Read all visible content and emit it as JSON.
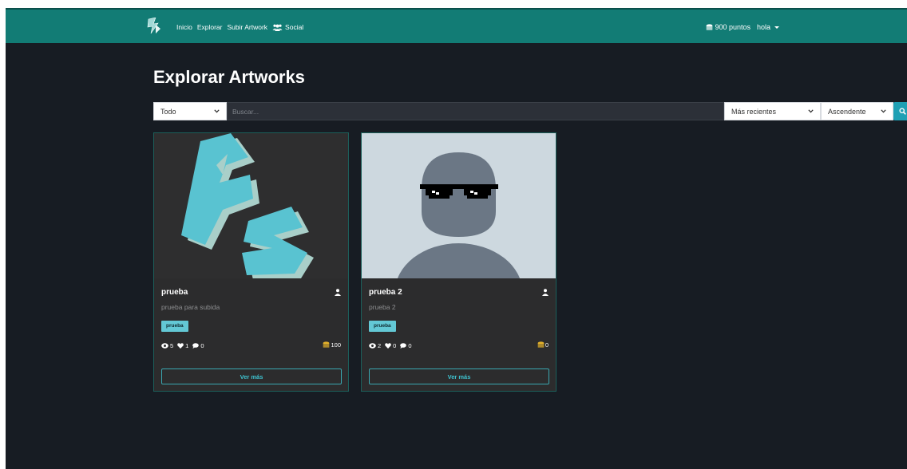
{
  "navbar": {
    "brand_icon": "artwork-logo-icon",
    "links": [
      {
        "label": "Inicio"
      },
      {
        "label": "Explorar"
      },
      {
        "label": "Subir Artwork"
      },
      {
        "label": "Social",
        "icon": "users-icon"
      }
    ],
    "points": {
      "label": "900 puntos",
      "icon": "coins-icon"
    },
    "user": {
      "label": "hola"
    }
  },
  "page": {
    "title": "Explorar Artworks"
  },
  "filters": {
    "category": "Todo",
    "search_placeholder": "Buscar...",
    "sort_by": "Más recientes",
    "order": "Ascendente",
    "search_icon": "search-icon"
  },
  "cards": [
    {
      "title": "prueba",
      "description": "prueba para subida",
      "tag": "prueba",
      "views": "5",
      "likes": "1",
      "comments": "0",
      "price": "100",
      "button": "Ver más"
    },
    {
      "title": "prueba 2",
      "description": "prueba 2",
      "tag": "prueba",
      "views": "2",
      "likes": "0",
      "comments": "0",
      "price": "0",
      "button": "Ver más"
    }
  ],
  "colors": {
    "navbar": "#127c75",
    "background": "#171c23",
    "card": "#2c2c2d",
    "accent": "#1fa0b4",
    "tag": "#63c8d5"
  }
}
